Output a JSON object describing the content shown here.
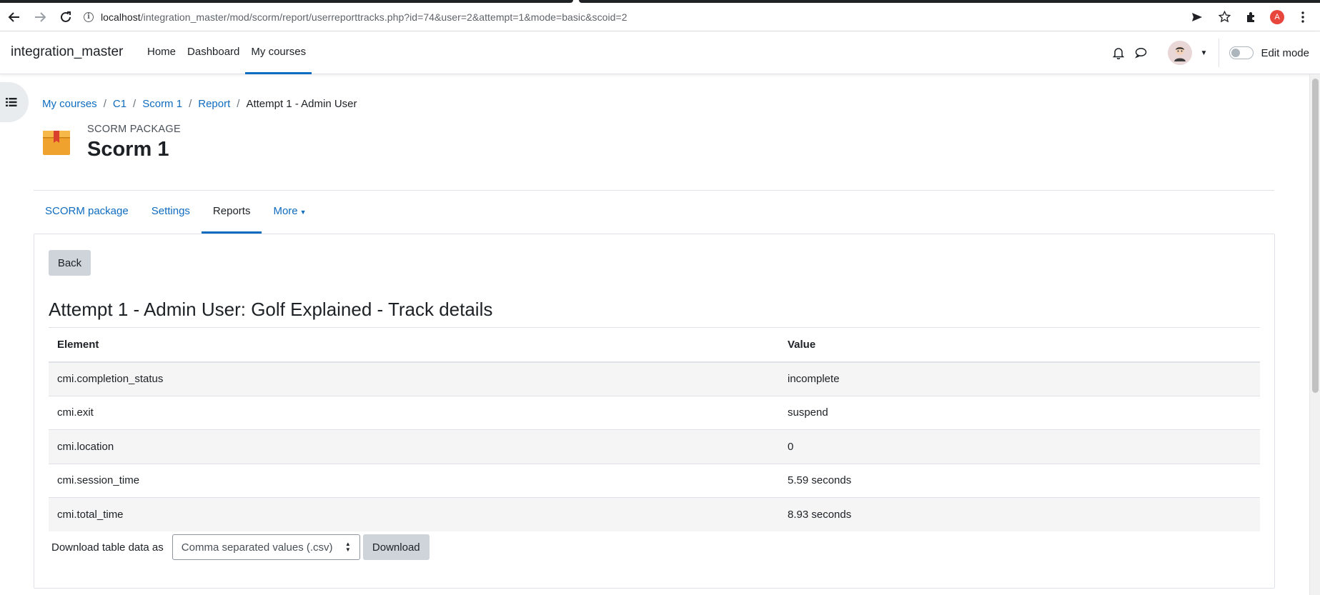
{
  "browser": {
    "url_host": "localhost",
    "url_path": "/integration_master/mod/scorm/report/userreporttracks.php?id=74&user=2&attempt=1&mode=basic&scoid=2",
    "profile_initial": "A"
  },
  "navbar": {
    "brand": "integration_master",
    "links": [
      {
        "label": "Home"
      },
      {
        "label": "Dashboard"
      },
      {
        "label": "My courses"
      }
    ],
    "edit_mode_label": "Edit mode"
  },
  "breadcrumb": {
    "items": [
      "My courses",
      "C1",
      "Scorm 1",
      "Report"
    ],
    "current": "Attempt 1 - Admin User"
  },
  "header": {
    "activity_type": "SCORM PACKAGE",
    "title": "Scorm 1"
  },
  "secondary_nav": {
    "tabs": [
      {
        "label": "SCORM package"
      },
      {
        "label": "Settings"
      },
      {
        "label": "Reports"
      },
      {
        "label": "More"
      }
    ]
  },
  "main": {
    "back_label": "Back",
    "track_title": "Attempt 1 - Admin User: Golf Explained - Track details",
    "table": {
      "headers": [
        "Element",
        "Value"
      ],
      "rows": [
        [
          "cmi.completion_status",
          "incomplete"
        ],
        [
          "cmi.exit",
          "suspend"
        ],
        [
          "cmi.location",
          "0"
        ],
        [
          "cmi.session_time",
          "5.59 seconds"
        ],
        [
          "cmi.total_time",
          "8.93 seconds"
        ]
      ]
    },
    "download": {
      "label": "Download table data as",
      "selected_format": "Comma separated values (.csv)",
      "button_label": "Download"
    }
  },
  "colors": {
    "link": "#0f6cbf",
    "text": "#1d2125",
    "button_secondary": "#ced4da",
    "table_stripe": "#f5f5f5"
  }
}
